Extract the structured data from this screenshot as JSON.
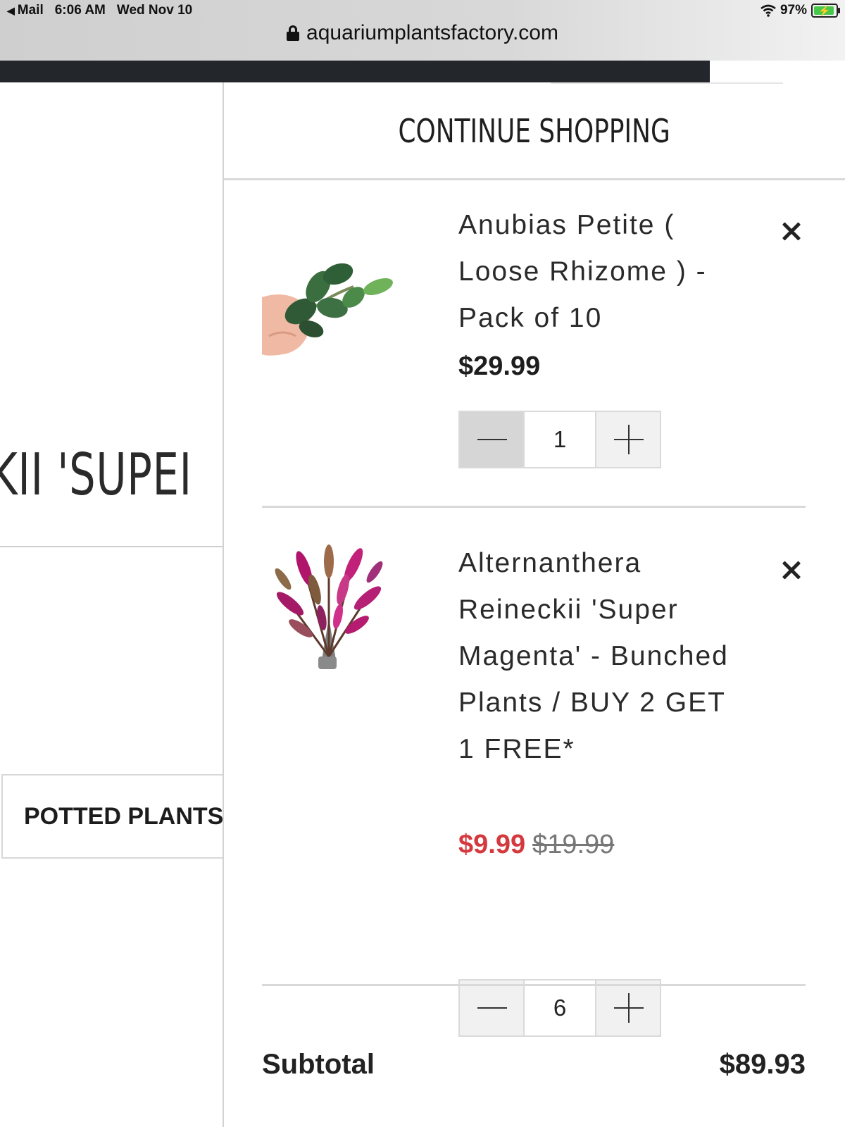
{
  "status_bar": {
    "back_app": "Mail",
    "time": "6:06 AM",
    "date": "Wed Nov 10",
    "battery": "97%",
    "page_load_progress": 0.84
  },
  "browser": {
    "url": "aquariumplantsfactory.com"
  },
  "background_page": {
    "product_title_fragment": "KII 'SUPEI",
    "category_button": "POTTED PLANTS"
  },
  "cart": {
    "continue_label": "CONTINUE SHOPPING",
    "items": [
      {
        "title": "Anubias Petite ( Loose Rhizome ) - Pack of 10",
        "price": "$29.99",
        "quantity": "1"
      },
      {
        "title": "Alternanthera Reineckii 'Super Magenta' - Bunched Plants / BUY 2 GET 1 FREE*",
        "sale_price": "$9.99",
        "compare_price": "$19.99",
        "quantity": "6"
      }
    ],
    "subtotal_label": "Subtotal",
    "subtotal_value": "$89.93"
  },
  "colors": {
    "sale_red": "#d4393d",
    "progress_dark": "#23262b",
    "battery_green": "#46c94a"
  }
}
